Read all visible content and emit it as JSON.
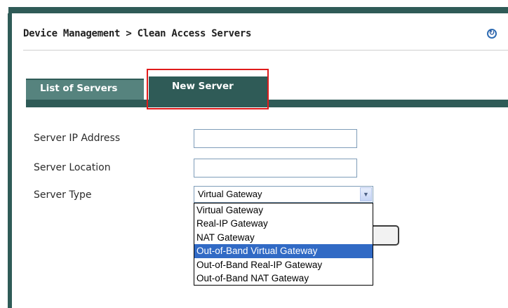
{
  "page": {
    "title": "Device Management > Clean Access Servers",
    "help_icon": "help-circle-icon"
  },
  "tabs": [
    {
      "label": "List of Servers",
      "active": false
    },
    {
      "label": "New Server",
      "active": true
    }
  ],
  "form": {
    "ip_label": "Server IP Address",
    "ip_value": "",
    "location_label": "Server Location",
    "location_value": "",
    "type_label": "Server Type",
    "type_selected": "Virtual Gateway",
    "type_options": [
      "Virtual Gateway",
      "Real-IP Gateway",
      "NAT Gateway",
      "Out-of-Band Virtual Gateway",
      "Out-of-Band Real-IP Gateway",
      "Out-of-Band NAT Gateway"
    ],
    "highlighted_option": "Out-of-Band Virtual Gateway"
  },
  "colors": {
    "brand": "#2f5b57",
    "tab_inactive": "#56837e",
    "highlight": "#e01b1b",
    "selection": "#316ac5"
  }
}
